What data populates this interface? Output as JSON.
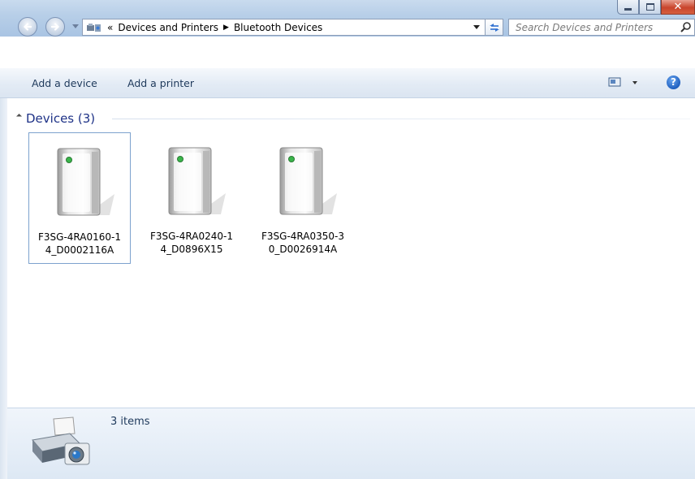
{
  "window": {
    "minimize_glyph": "minimize",
    "maximize_glyph": "maximize",
    "close_glyph": "✕"
  },
  "address": {
    "overflow": "«",
    "crumbs": [
      "Devices and Printers",
      "Bluetooth Devices"
    ],
    "separator": "▶"
  },
  "search": {
    "placeholder": "Search Devices and Printers"
  },
  "commands": {
    "add_device": "Add a device",
    "add_printer": "Add a printer",
    "help": "?"
  },
  "group": {
    "title": "Devices (3)"
  },
  "devices": [
    {
      "line1": "F3SG-4RA0160-1",
      "line2": "4_D0002116A",
      "selected": true
    },
    {
      "line1": "F3SG-4RA0240-1",
      "line2": "4_D0896X15",
      "selected": false
    },
    {
      "line1": "F3SG-4RA0350-3",
      "line2": "0_D0026914A",
      "selected": false
    }
  ],
  "details": {
    "count_text": "3 items"
  },
  "colors": {
    "accent": "#1e3287",
    "link": "#1e395b",
    "selection_border": "#7da2ce",
    "status_led": "#3ab54a"
  }
}
